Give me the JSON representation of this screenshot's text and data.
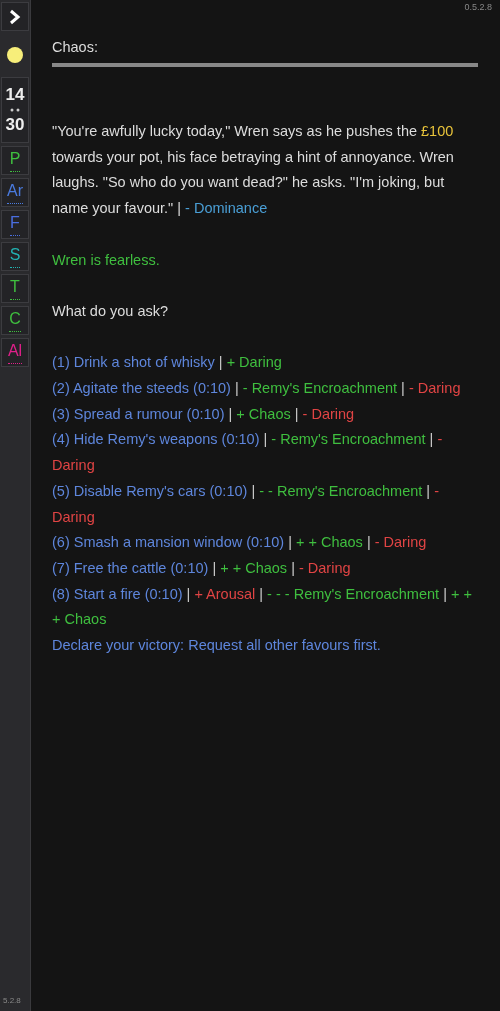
{
  "version": "0.5.2.8",
  "sidebar": {
    "time": {
      "hours": "14",
      "minutes": "30"
    },
    "stats": [
      {
        "label": "P",
        "color": "#3fbf3f"
      },
      {
        "label": "Ar",
        "color": "#4a7be0"
      },
      {
        "label": "F",
        "color": "#4a6ee0"
      },
      {
        "label": "S",
        "color": "#22b3b3"
      },
      {
        "label": "T",
        "color": "#3fbf3f"
      },
      {
        "label": "C",
        "color": "#3fbf3f"
      },
      {
        "label": "Al",
        "color": "#e0208a"
      }
    ],
    "footer_version": "5.2.8"
  },
  "heading": "Chaos:",
  "story": [
    {
      "kind": "plain",
      "text": "\"You're awfully lucky today,\" Wren says as he pushes the "
    },
    {
      "kind": "money",
      "text": "£100"
    },
    {
      "kind": "plain",
      "text": " towards your pot, his face betraying a hint of annoyance. Wren laughs. \"So who do you want dead?\" he asks. \"I'm joking, but name your favour.\" | "
    },
    {
      "kind": "link",
      "text": "- Dominance"
    }
  ],
  "trait": "Wren is fearless.",
  "question": "What do you ask?",
  "options": [
    [
      {
        "kind": "action",
        "text": "(1) Drink a shot of whisky"
      },
      {
        "kind": "sep",
        "text": "|"
      },
      {
        "kind": "good",
        "text": "+ Daring"
      }
    ],
    [
      {
        "kind": "action",
        "text": "(2) Agitate the steeds (0:10)"
      },
      {
        "kind": "sep",
        "text": "|"
      },
      {
        "kind": "good",
        "text": "- Remy's Encroachment"
      },
      {
        "kind": "sep",
        "text": "|"
      },
      {
        "kind": "bad",
        "text": "- Daring"
      }
    ],
    [
      {
        "kind": "action",
        "text": "(3) Spread a rumour (0:10)"
      },
      {
        "kind": "sep",
        "text": "|"
      },
      {
        "kind": "good",
        "text": "+ Chaos"
      },
      {
        "kind": "sep",
        "text": "|"
      },
      {
        "kind": "bad",
        "text": "- Daring"
      }
    ],
    [
      {
        "kind": "action",
        "text": "(4) Hide Remy's weapons (0:10)"
      },
      {
        "kind": "sep",
        "text": "|"
      },
      {
        "kind": "good",
        "text": "- Remy's Encroachment"
      },
      {
        "kind": "sep",
        "text": "|"
      },
      {
        "kind": "bad",
        "text": "-"
      },
      {
        "kind": "bad",
        "text": "Daring"
      }
    ],
    [
      {
        "kind": "action",
        "text": "(5) Disable Remy's cars (0:10)"
      },
      {
        "kind": "sep",
        "text": "|"
      },
      {
        "kind": "good",
        "text": "- - Remy's Encroachment"
      },
      {
        "kind": "sep",
        "text": "|"
      },
      {
        "kind": "bad",
        "text": "-"
      },
      {
        "kind": "bad",
        "text": "Daring"
      }
    ],
    [
      {
        "kind": "action",
        "text": "(6) Smash a mansion window (0:10)"
      },
      {
        "kind": "sep",
        "text": "|"
      },
      {
        "kind": "good",
        "text": "+ + Chaos"
      },
      {
        "kind": "sep",
        "text": "|"
      },
      {
        "kind": "bad",
        "text": "- Daring"
      }
    ],
    [
      {
        "kind": "action",
        "text": "(7) Free the cattle (0:10)"
      },
      {
        "kind": "sep",
        "text": "|"
      },
      {
        "kind": "good",
        "text": "+ + Chaos"
      },
      {
        "kind": "sep",
        "text": "|"
      },
      {
        "kind": "bad",
        "text": "- Daring"
      }
    ],
    [
      {
        "kind": "action",
        "text": "(8) Start a fire (0:10)"
      },
      {
        "kind": "sep",
        "text": "|"
      },
      {
        "kind": "bad",
        "text": "+ Arousal"
      },
      {
        "kind": "sep",
        "text": "|"
      },
      {
        "kind": "good",
        "text": "- - - Remy's Encroachment"
      },
      {
        "kind": "sep",
        "text": "|"
      },
      {
        "kind": "good",
        "text": "+ +"
      },
      {
        "kind": "good",
        "text": "+ Chaos"
      }
    ],
    [
      {
        "kind": "action",
        "text": "Declare your victory: Request all other favours first."
      }
    ]
  ]
}
